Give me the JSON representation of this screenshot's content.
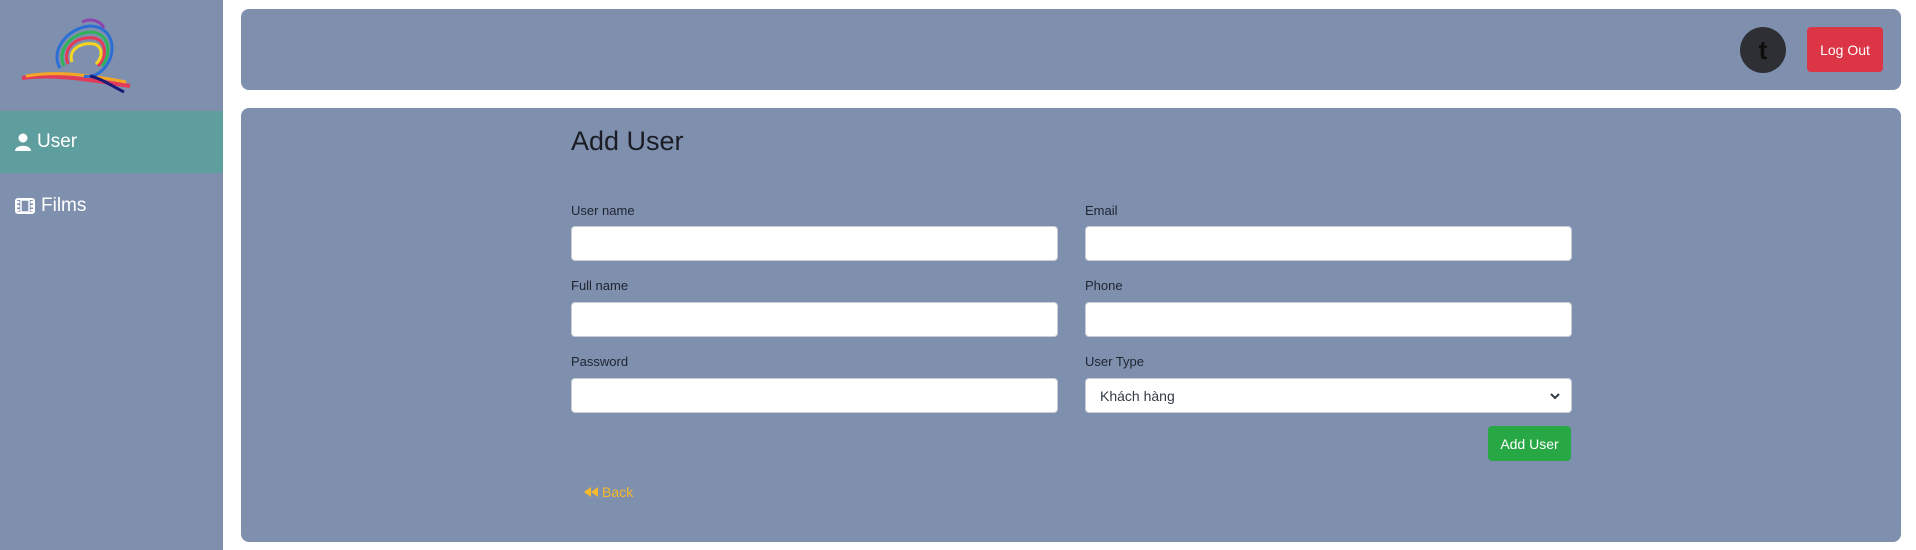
{
  "sidebar": {
    "items": [
      {
        "label": "User",
        "icon": "user-icon",
        "active": true
      },
      {
        "label": "Films",
        "icon": "film-icon",
        "active": false
      }
    ]
  },
  "header": {
    "avatar_initial": "t",
    "logout_label": "Log Out"
  },
  "form": {
    "title": "Add User",
    "username_label": "User name",
    "email_label": "Email",
    "fullname_label": "Full name",
    "phone_label": "Phone",
    "password_label": "Password",
    "usertype_label": "User Type",
    "usertype_value": "Khách hàng",
    "submit_label": "Add User",
    "back_label": "Back"
  },
  "colors": {
    "panel_bg": "#7f8fae",
    "active_nav": "#5f9e9e",
    "logout": "#dc3545",
    "submit": "#28a745",
    "back_link": "#f5b92a"
  }
}
